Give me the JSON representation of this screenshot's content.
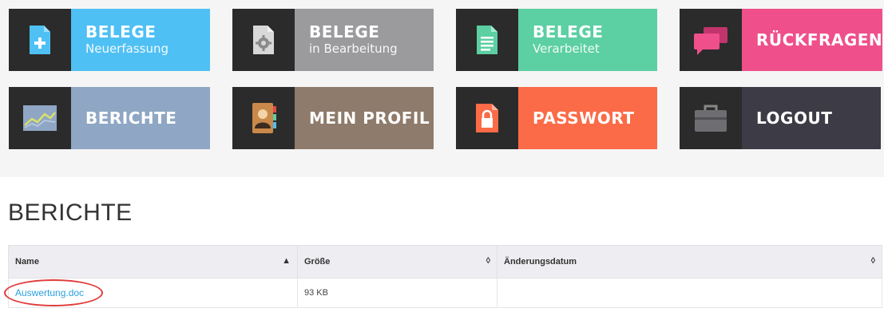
{
  "tiles": [
    {
      "line1": "BELEGE",
      "line2": "Neuerfassung",
      "color": "#4fc0f4",
      "icon": "document-plus-icon"
    },
    {
      "line1": "BELEGE",
      "line2": "in Bearbeitung",
      "color": "#9b9a9c",
      "icon": "document-gear-icon"
    },
    {
      "line1": "BELEGE",
      "line2": "Verarbeitet",
      "color": "#5ccfa3",
      "icon": "document-lines-icon"
    },
    {
      "line1": "RÜCKFRAGEN",
      "line2": "",
      "color": "#ef4f8b",
      "icon": "speech-bubbles-icon"
    },
    {
      "line1": "BERICHTE",
      "line2": "",
      "color": "#8fa7c4",
      "icon": "chart-icon"
    },
    {
      "line1": "MEIN PROFIL",
      "line2": "",
      "color": "#8f7b6b",
      "icon": "address-book-icon"
    },
    {
      "line1": "PASSWORT",
      "line2": "",
      "color": "#fb6b47",
      "icon": "lock-icon"
    },
    {
      "line1": "LOGOUT",
      "line2": "",
      "color": "#3d3b45",
      "icon": "briefcase-icon"
    }
  ],
  "section": {
    "title": "BERICHTE"
  },
  "table": {
    "headers": {
      "name": "Name",
      "size": "Größe",
      "date": "Änderungsdatum"
    },
    "sort_icons": {
      "name": "▲",
      "size": "◊",
      "date": "◊"
    },
    "rows": [
      {
        "name": "Auswertung.doc",
        "size": "93 KB",
        "date": ""
      }
    ]
  },
  "annotation": {
    "color": "#e23a3a"
  }
}
